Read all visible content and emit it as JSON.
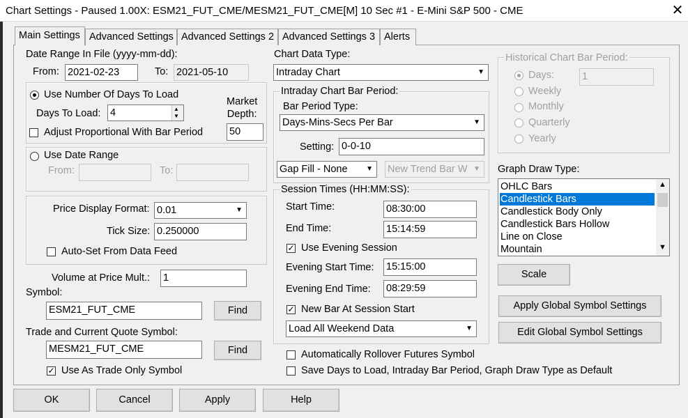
{
  "window": {
    "title": "Chart Settings - Paused 1.00X: ESM21_FUT_CME/MESM21_FUT_CME[M]  10 Sec   #1 - E-Mini S&P 500 - CME",
    "close": "✕"
  },
  "tabs": [
    "Main Settings",
    "Advanced Settings",
    "Advanced Settings 2",
    "Advanced Settings 3",
    "Alerts"
  ],
  "date_range": {
    "label": "Date Range In File (yyyy-mm-dd):",
    "from_label": "From:",
    "from_value": "2021-02-23",
    "to_label": "To:",
    "to_value": "2021-05-10"
  },
  "days_group": {
    "use_days_label": "Use Number Of Days To Load",
    "days_to_load_label": "Days To Load:",
    "days_to_load_value": "4",
    "market_depth_label": "Market\nDepth:",
    "market_depth_value": "50",
    "adjust_label": "Adjust Proportional With Bar Period"
  },
  "date_range_group": {
    "label": "Use Date Range",
    "from_label": "From:",
    "to_label": "To:"
  },
  "price_group": {
    "format_label": "Price Display Format:",
    "format_value": "0.01",
    "tick_label": "Tick Size:",
    "tick_value": "0.250000",
    "autoset_label": "Auto-Set From Data Feed"
  },
  "volume": {
    "label": "Volume at Price Mult.:",
    "value": "1"
  },
  "symbol": {
    "label": "Symbol:",
    "value": "ESM21_FUT_CME",
    "find": "Find"
  },
  "trade_symbol": {
    "label": "Trade and Current Quote Symbol:",
    "value": "MESM21_FUT_CME",
    "find": "Find",
    "trade_only_label": "Use As Trade Only Symbol"
  },
  "chart_data_type": {
    "label": "Chart Data Type:",
    "value": "Intraday Chart"
  },
  "intraday_period": {
    "label": "Intraday Chart Bar Period:",
    "bar_period_type_label": "Bar Period Type:",
    "bar_period_type_value": "Days-Mins-Secs Per Bar",
    "setting_label": "Setting:",
    "setting_value": "0-0-10",
    "gap_fill": "Gap Fill - None",
    "new_trend": "New Trend Bar W"
  },
  "session": {
    "label": "Session Times (HH:MM:SS):",
    "start_label": "Start Time:",
    "start_value": "08:30:00",
    "end_label": "End Time:",
    "end_value": "15:14:59",
    "evening_label": "Use Evening Session",
    "evening_start_label": "Evening Start Time:",
    "evening_start_value": "15:15:00",
    "evening_end_label": "Evening End Time:",
    "evening_end_value": "08:29:59",
    "new_bar_label": "New Bar At Session Start",
    "weekend_value": "Load All Weekend Data"
  },
  "rollover_label": "Automatically Rollover Futures Symbol",
  "save_default_label": "Save Days to Load, Intraday Bar Period, Graph Draw Type as Default",
  "historical": {
    "label": "Historical Chart Bar Period:",
    "options": [
      "Days:",
      "Weekly",
      "Monthly",
      "Quarterly",
      "Yearly"
    ],
    "days_value": "1"
  },
  "graph_draw": {
    "label": "Graph Draw Type:",
    "items": [
      "OHLC Bars",
      "Candlestick Bars",
      "Candlestick Body Only",
      "Candlestick Bars Hollow",
      "Line on Close",
      "Mountain"
    ],
    "selected": "Candlestick Bars"
  },
  "right_buttons": {
    "scale": "Scale",
    "apply_global": "Apply Global Symbol Settings",
    "edit_global": "Edit Global Symbol Settings"
  },
  "bottom_buttons": {
    "ok": "OK",
    "cancel": "Cancel",
    "apply": "Apply",
    "help": "Help"
  },
  "glyphs": {
    "check": "✓",
    "down": "▼",
    "up": "▲",
    "spin_up": "▲",
    "spin_down": "▼"
  },
  "colors": {
    "selection": "#0078d7"
  }
}
